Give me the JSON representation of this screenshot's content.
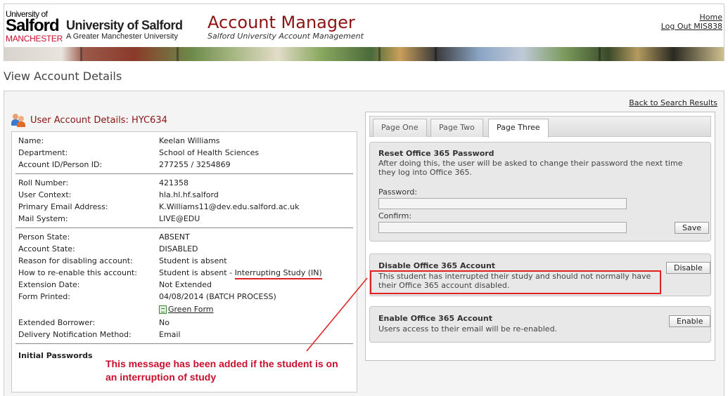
{
  "header": {
    "logo": {
      "small": "University of",
      "big": "Salford",
      "city": "MANCHESTER"
    },
    "university_name": "University of Salford",
    "university_tagline": "A Greater Manchester University",
    "app_title": "Account Manager",
    "app_subtitle": "Salford University Account Management",
    "links": {
      "home": "Home",
      "logout": "Log Out MIS838"
    }
  },
  "page_title": "View Account Details",
  "back_link": "Back to Search Results",
  "account": {
    "title": "User Account Details: HYC634",
    "groups": [
      [
        {
          "label": "Name:",
          "value": "Keelan Williams"
        },
        {
          "label": "Department:",
          "value": "School of Health Sciences"
        },
        {
          "label": "Account ID/Person ID:",
          "value": "277255 / 3254869"
        }
      ],
      [
        {
          "label": "Roll Number:",
          "value": "421358"
        },
        {
          "label": "User Context:",
          "value": "hla.hl.hf.salford"
        },
        {
          "label": "Primary Email Address:",
          "value": "K.Williams11@dev.edu.salford.ac.uk"
        },
        {
          "label": "Mail System:",
          "value": "LIVE@EDU"
        }
      ],
      [
        {
          "label": "Person State:",
          "value": "ABSENT"
        },
        {
          "label": "Account State:",
          "value": "DISABLED"
        },
        {
          "label": "Reason for disabling account:",
          "value": "Student is absent"
        },
        {
          "label": "How to re-enable this account:",
          "value": "Student is absent - ",
          "value_extra": "Interrupting Study (IN)"
        },
        {
          "label": "Extension Date:",
          "value": "Not Extended"
        },
        {
          "label": "Form Printed:",
          "value": "04/08/2014 (BATCH PROCESS)"
        },
        {
          "label": "",
          "value": "Green Form",
          "link": true
        },
        {
          "label": "Extended Borrower:",
          "value": "No"
        },
        {
          "label": "Delivery Notification Method:",
          "value": "Email"
        }
      ]
    ],
    "initial_passwords": "Initial Passwords"
  },
  "annotation": "This message has been added if the student is on an interruption of study",
  "tabs": [
    "Page One",
    "Page Two",
    "Page Three"
  ],
  "active_tab": "Page Three",
  "reset": {
    "title": "Reset Office 365 Password",
    "desc": "After doing this, the user will be asked to change their password the next time they log into Office 365.",
    "password_label": "Password:",
    "confirm_label": "Confirm:",
    "save": "Save"
  },
  "disable": {
    "title": "Disable Office 365 Account",
    "button": "Disable",
    "message": "This student has interrupted their study and should not normally have their Office 365 account disabled."
  },
  "enable": {
    "title": "Enable Office 365 Account",
    "desc": "Users access to their email will be re-enabled.",
    "button": "Enable"
  },
  "colors": {
    "accent": "#8b1414",
    "annotation": "#c8102e",
    "highlight": "#e02020"
  }
}
